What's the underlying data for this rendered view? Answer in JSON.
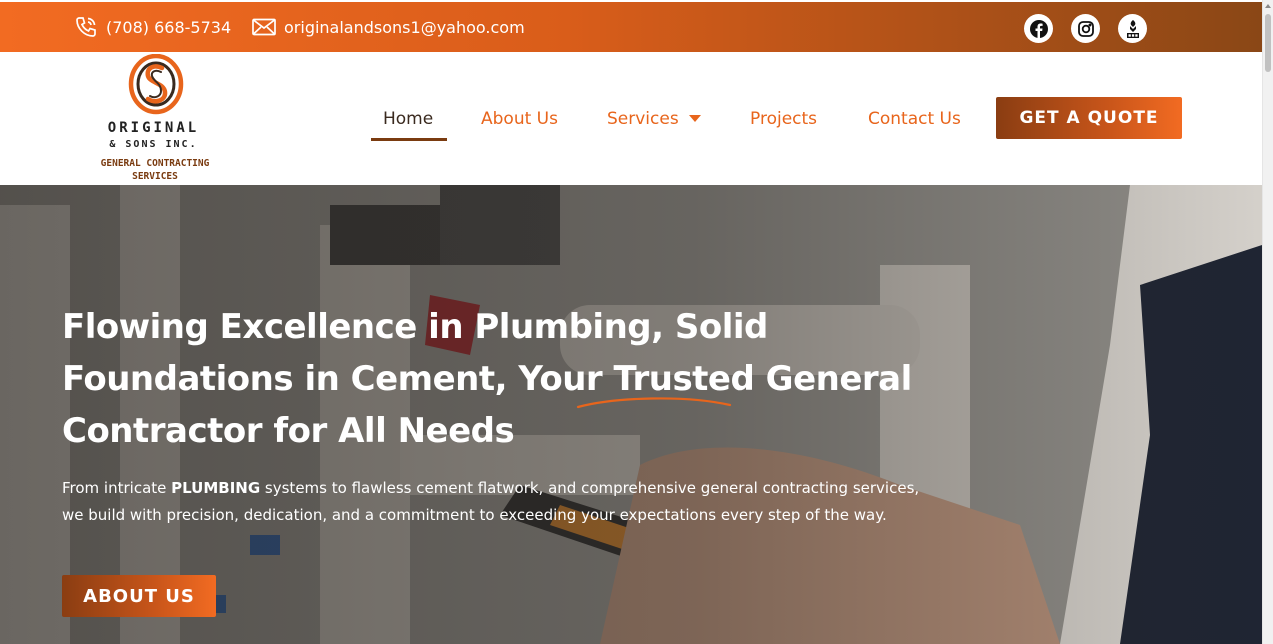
{
  "topbar": {
    "phone": "(708) 668-5734",
    "email": "originalandsons1@yahoo.com",
    "social": [
      "facebook-icon",
      "instagram-icon",
      "bbb-icon"
    ]
  },
  "logo": {
    "line1": "ORIGINAL",
    "line2": "& SONS INC.",
    "tagline1": "GENERAL CONTRACTING",
    "tagline2": "SERVICES"
  },
  "nav": {
    "items": [
      {
        "label": "Home",
        "active": true
      },
      {
        "label": "About Us"
      },
      {
        "label": "Services",
        "has_dropdown": true
      },
      {
        "label": "Projects"
      },
      {
        "label": "Contact Us"
      }
    ],
    "cta": "GET A QUOTE"
  },
  "hero": {
    "title_line1": "Flowing Excellence in Plumbing, Solid",
    "title_line2a": "Foundations in Cement, Your ",
    "title_highlight": "Trusted",
    "title_line2b": " General",
    "title_line3": "Contractor for All Needs",
    "text_before": "From intricate ",
    "text_bold": "PLUMBING",
    "text_after": " systems to flawless cement flatwork, and comprehensive general contracting services, we build with precision, dedication, and a commitment to exceeding your expectations every step of the way.",
    "button": "ABOUT US"
  },
  "colors": {
    "accent": "#f26b22",
    "accent_dark": "#8a3d12",
    "nav_active": "#3a2a1f"
  }
}
